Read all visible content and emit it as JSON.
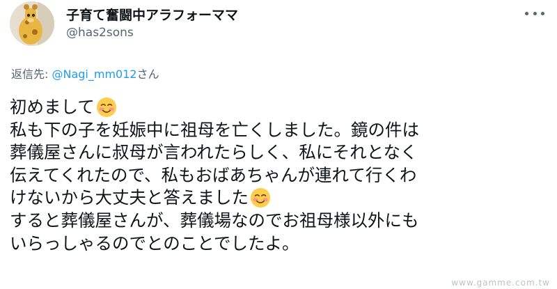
{
  "author": {
    "display_name": "子育て奮闘中アラフォーママ",
    "handle": "@has2sons",
    "avatar_icon": "giraffe-avatar-icon"
  },
  "more_icon": "more-horizontal-icon",
  "reply": {
    "prefix": "返信先: ",
    "mention": "@Nagi_mm012",
    "suffix": "さん"
  },
  "tweet": {
    "lines": [
      "初めまして",
      "私も下の子を妊娠中に祖母を亡くしました。鏡の件は",
      "葬儀屋さんに叔母が言われたらしく、私にそれとなく",
      "伝えてくれたので、私もおばあちゃんが連れて行くわ",
      "けないから大丈夫と答えました",
      "すると葬儀屋さんが、葬儀場なのでお祖母様以外にも",
      "いらっしゃるのでとのことでしたよ。"
    ],
    "emoji": "smiling-face-with-smiling-eyes-emoji"
  },
  "watermark": "www.gamme.com.tw",
  "colors": {
    "text": "#0f1419",
    "secondary": "#536471",
    "link": "#1d9bf0",
    "background": "#ffffff"
  }
}
